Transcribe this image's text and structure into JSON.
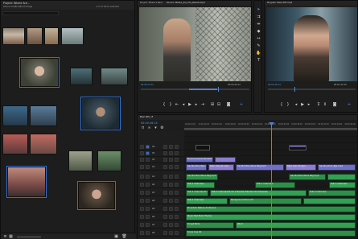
{
  "project": {
    "title": "Project: Where Are...",
    "path": "Where Are(Bin)/Bin/Footage",
    "item_count": "4 of 16 items selected",
    "clip_labels": [
      "",
      "",
      "",
      "",
      "",
      "",
      "",
      "",
      "",
      "",
      "",
      "",
      "",
      "",
      "",
      "",
      ""
    ]
  },
  "source": {
    "tab1": "Project: Where's Bear",
    "tab2": "Source: Where_Are_The_Robots.mp4",
    "timecode": "00:00:27:04",
    "end": "00:00:44:14"
  },
  "program": {
    "tab": "Program: Bear 005.mp4",
    "timecode": "00:00:26:14",
    "end": "00:01:22:15"
  },
  "timeline": {
    "sequence": "Bear 005_v3",
    "timecode": "00:00:26:14",
    "ruler": [
      "00:00:12:00",
      "00:00:14:00",
      "00:00:16:00",
      "00:00:18:00",
      "00:00:20:00",
      "00:00:22:00",
      "00:00:24:00",
      "00:00:26:00",
      "00:00:28:00",
      "00:00:30:00",
      "00:00:32:00",
      "00:00:34:00",
      "00:00:36:00"
    ],
    "tracks": [
      "V4",
      "V3",
      "V2",
      "V1",
      "A1",
      "A2",
      "A3",
      "A4",
      "A5",
      "A6",
      "A7",
      "A8"
    ],
    "clips": {
      "v2a": "Marina Sandia Mountain",
      "v1a": "Sandia Mountain Bkg.mp4",
      "v1b": "Bear Cub_01.mp4",
      "v1c": "Sandia Mountains Bkg.mp4",
      "v1d": "Bear Cub 03.mp4",
      "v1e": "Sandia_Rock_Bgs.mp4",
      "a1a": "Sandia Mountains Bkg.mp4",
      "a1b": "Sandia Mountains Bkg.mp4",
      "a2a": "Talk 1 Interview",
      "a2b": "Talk 2 Interview",
      "a2c": "Talk 3 Interview",
      "a3a": "Talk 4 Interview B-roll",
      "a3b": "Talk 5 Interview B-roll 1 Bundle Hike Nov 03 Interview",
      "a3c": "Talk 6 Interview",
      "a4a": "Talk 1 Interview",
      "a4b": "Background Voice VO",
      "a5a": "Mountain Nature Ambience",
      "a6a": "Music Bed Main Theme",
      "a7a": "Forest Birds",
      "a7b": "Wind",
      "a8a": "Score Cue 02"
    }
  },
  "colors": {
    "accent": "#2f6fd6",
    "playhead": "#4a86e8",
    "video_clip": "#6f6fc7",
    "audio_clip": "#2f8f4a"
  }
}
